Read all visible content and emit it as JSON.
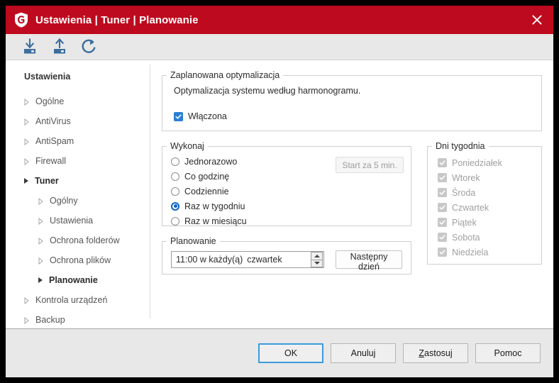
{
  "window": {
    "title": "Ustawienia | Tuner | Planowanie",
    "logo_icon": "shield-g-logo",
    "close_icon": "close-icon",
    "accent_red": "#be0a1e",
    "accent_blue": "#0a64c8",
    "focus_blue": "#3a9bdc"
  },
  "toolbar": {
    "items": [
      {
        "icon": "import-settings-icon",
        "name": "import-settings"
      },
      {
        "icon": "export-settings-icon",
        "name": "export-settings"
      },
      {
        "icon": "reset-settings-icon",
        "name": "reset-settings"
      }
    ]
  },
  "sidebar": {
    "title": "Ustawienia",
    "items": [
      {
        "label": "Ogólne",
        "level": 0,
        "selected": false
      },
      {
        "label": "AntiVirus",
        "level": 0,
        "selected": false
      },
      {
        "label": "AntiSpam",
        "level": 0,
        "selected": false
      },
      {
        "label": "Firewall",
        "level": 0,
        "selected": false
      },
      {
        "label": "Tuner",
        "level": 0,
        "selected": true
      },
      {
        "label": "Ogólny",
        "level": 1,
        "selected": false
      },
      {
        "label": "Ustawienia",
        "level": 1,
        "selected": false
      },
      {
        "label": "Ochrona folderów",
        "level": 1,
        "selected": false
      },
      {
        "label": "Ochrona plików",
        "level": 1,
        "selected": false
      },
      {
        "label": "Planowanie",
        "level": 1,
        "selected": true
      },
      {
        "label": "Kontrola urządzeń",
        "level": 0,
        "selected": false
      },
      {
        "label": "Backup",
        "level": 0,
        "selected": false
      }
    ]
  },
  "optimization": {
    "legend": "Zaplanowana optymalizacja",
    "description": "Optymalizacja systemu według harmonogramu.",
    "enabled_label": "Włączona",
    "enabled_checked": true
  },
  "execute": {
    "legend": "Wykonaj",
    "start_button": "Start za 5 min.",
    "start_button_disabled": true,
    "options": [
      {
        "label": "Jednorazowo",
        "selected": false
      },
      {
        "label": "Co godzinę",
        "selected": false
      },
      {
        "label": "Codziennie",
        "selected": false
      },
      {
        "label": "Raz w tygodniu",
        "selected": true
      },
      {
        "label": "Raz w miesiącu",
        "selected": false
      }
    ]
  },
  "schedule": {
    "legend": "Planowanie",
    "time_value": "11:00 w każdy(ą)",
    "day_value": "czwartek",
    "spinner_icon": "spinner-up-down-icon",
    "next_day_button": "Następny dzień"
  },
  "weekdays": {
    "legend": "Dni tygodnia",
    "items": [
      {
        "label": "Poniedziałek",
        "checked": true,
        "disabled": true
      },
      {
        "label": "Wtorek",
        "checked": true,
        "disabled": true
      },
      {
        "label": "Środa",
        "checked": true,
        "disabled": true
      },
      {
        "label": "Czwartek",
        "checked": true,
        "disabled": true
      },
      {
        "label": "Piątek",
        "checked": true,
        "disabled": true
      },
      {
        "label": "Sobota",
        "checked": true,
        "disabled": true
      },
      {
        "label": "Niedziela",
        "checked": true,
        "disabled": true
      }
    ]
  },
  "footer": {
    "buttons": [
      {
        "label": "OK",
        "primary": true,
        "accel": ""
      },
      {
        "label": "Anuluj",
        "primary": false,
        "accel": ""
      },
      {
        "label": "Zastosuj",
        "primary": false,
        "accel": "Z"
      },
      {
        "label": "Pomoc",
        "primary": false,
        "accel": ""
      }
    ]
  }
}
